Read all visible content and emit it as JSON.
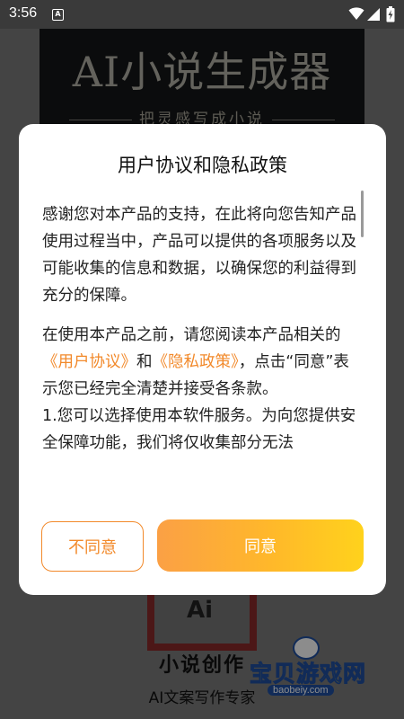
{
  "status_bar": {
    "time": "3:56",
    "notification_badge": "A",
    "icons": [
      "wifi-icon",
      "signal-icon",
      "battery-charging-icon"
    ]
  },
  "background_app": {
    "banner_title": "AI小说生成器",
    "banner_slogan": "把灵感写成小说",
    "book_logo_text": "Ai",
    "app_title": "小说创作",
    "app_subtitle": "AI文案写作专家"
  },
  "watermark": {
    "main": "宝贝游戏网",
    "url": "baobeiy.com"
  },
  "dialog": {
    "title": "用户协议和隐私政策",
    "para1": "感谢您对本产品的支持，在此将向您告知产品使用过程当中，产品可以提供的各项服务以及可能收集的信息和数据，以确保您的利益得到充分的保障。",
    "para2_pre": "在使用本产品之前，请您阅读本产品相关的",
    "link_user_agreement": "《用户协议》",
    "para2_and": "和",
    "link_privacy_policy": "《隐私政策》",
    "para2_post": "，点击“同意”表示您已经完全清楚并接受各条款。",
    "para3": "1.您可以选择使用本软件服务。为向您提供安全保障功能，我们将仅收集部分无法",
    "buttons": {
      "disagree": "不同意",
      "agree": "同意"
    }
  },
  "colors": {
    "accent": "#f2892a",
    "agree_gradient_start": "#fba045",
    "agree_gradient_end": "#ffd21c"
  }
}
